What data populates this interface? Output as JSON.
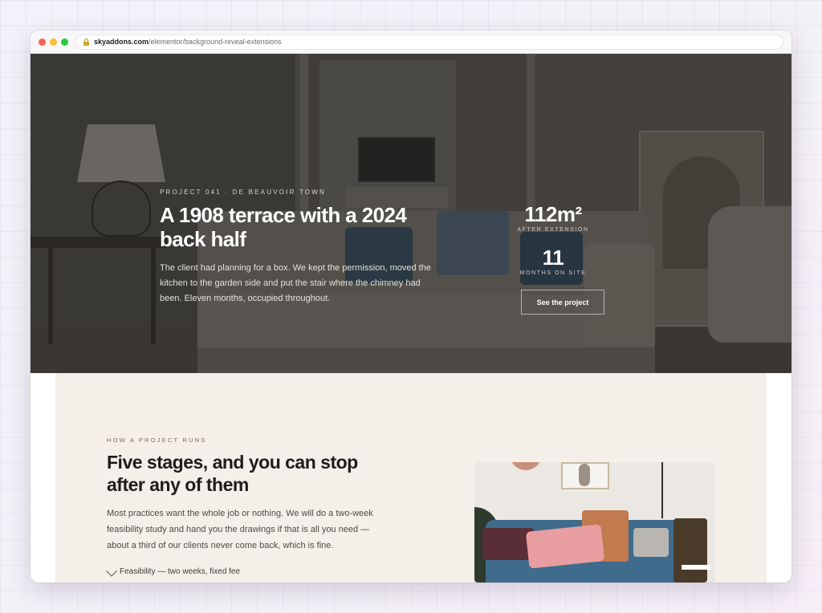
{
  "browser": {
    "url_host": "skyaddons.com",
    "url_path": "/elementor/background-reveal-extensions"
  },
  "hero": {
    "eyebrow": "PROJECT 041 · DE BEAUVOIR TOWN",
    "title": "A 1908 terrace with a 2024 back half",
    "description": "The client had planning for a box. We kept the permission, moved the kitchen to the garden side and put the stair where the chimney had been. Eleven months, occupied throughout.",
    "stats": [
      {
        "value": "112m²",
        "label": "AFTER EXTENSION"
      },
      {
        "value": "11",
        "label": "MONTHS ON SITE"
      }
    ],
    "cta_label": "See the project"
  },
  "section": {
    "eyebrow": "HOW A PROJECT RUNS",
    "title": "Five stages, and you can stop after any of them",
    "description": "Most practices want the whole job or nothing. We will do a two-week feasibility study and hand you the drawings if that is all you need — about a third of our clients never come back, which is fine.",
    "feature": "Feasibility — two weeks, fixed fee",
    "feature_icon": "compass-icon"
  }
}
